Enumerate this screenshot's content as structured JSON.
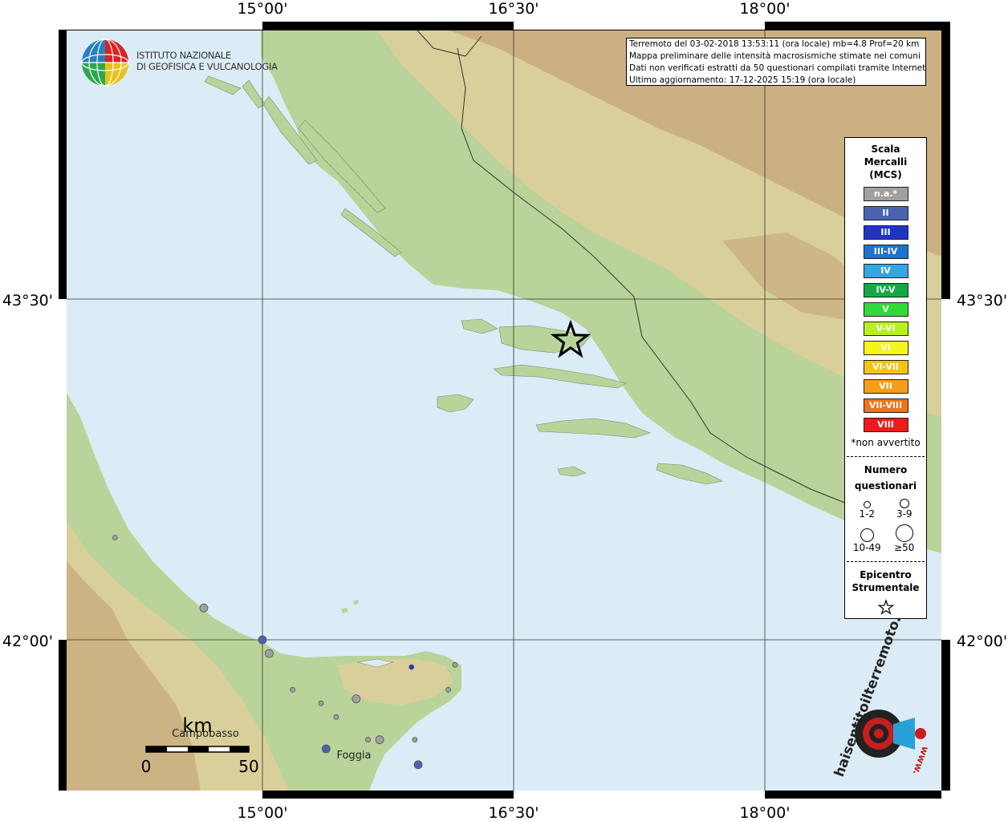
{
  "map": {
    "top_axis_labels": [
      "15°00'",
      "16°30'",
      "18°00'"
    ],
    "bottom_axis_labels": [
      "15°00'",
      "16°30'",
      "18°00'"
    ],
    "left_axis_labels": [
      "43°30'",
      "42°00'"
    ],
    "right_axis_labels": [
      "43°30'",
      "42°00'"
    ],
    "colors": {
      "sea": "#dcecf6",
      "lowland": "#b9d39a",
      "hills": "#d9cf9a",
      "mountain": "#c6a77a",
      "frame": "#000000"
    },
    "places": [
      "Campobasso",
      "Foggia"
    ],
    "scale_bar": {
      "unit": "km",
      "min_label": "0",
      "max_label": "50"
    },
    "epicenter": {
      "symbol": "star"
    },
    "observation_points": [
      {
        "lon": 14.12,
        "lat": 42.45,
        "intensity": "n.a.*",
        "size": "1-2"
      },
      {
        "lon": 14.65,
        "lat": 42.14,
        "intensity": "n.a.*",
        "size": "3-9"
      },
      {
        "lon": 15.0,
        "lat": 42.0,
        "intensity": "II",
        "size": "3-9"
      },
      {
        "lon": 15.04,
        "lat": 41.94,
        "intensity": "n.a.*",
        "size": "3-9"
      },
      {
        "lon": 15.18,
        "lat": 41.78,
        "intensity": "n.a.*",
        "size": "1-2"
      },
      {
        "lon": 15.35,
        "lat": 41.72,
        "intensity": "n.a.*",
        "size": "1-2"
      },
      {
        "lon": 15.44,
        "lat": 41.66,
        "intensity": "n.a.*",
        "size": "1-2"
      },
      {
        "lon": 15.56,
        "lat": 41.74,
        "intensity": "n.a.*",
        "size": "3-9"
      },
      {
        "lon": 15.38,
        "lat": 41.52,
        "intensity": "II",
        "size": "3-9"
      },
      {
        "lon": 15.63,
        "lat": 41.56,
        "intensity": "n.a.*",
        "size": "1-2"
      },
      {
        "lon": 15.7,
        "lat": 41.56,
        "intensity": "n.a.*",
        "size": "3-9"
      },
      {
        "lon": 15.91,
        "lat": 41.56,
        "intensity": "n.a.*",
        "size": "1-2"
      },
      {
        "lon": 15.89,
        "lat": 41.88,
        "intensity": "III",
        "size": "1-2"
      },
      {
        "lon": 16.11,
        "lat": 41.78,
        "intensity": "n.a.*",
        "size": "1-2"
      },
      {
        "lon": 16.15,
        "lat": 41.89,
        "intensity": "n.a.*",
        "size": "1-2"
      },
      {
        "lon": 15.93,
        "lat": 41.45,
        "intensity": "II",
        "size": "3-9"
      }
    ]
  },
  "logo": {
    "line1": "ISTITUTO NAZIONALE",
    "line2": "DI GEOFISICA E VULCANOLOGIA"
  },
  "info": {
    "line1": "Terremoto del 03-02-2018 13:53:11 (ora locale) mb=4.8 Prof=20 km",
    "line2": "Mappa preliminare delle intensità macrosismiche stimate nei comuni",
    "line3": "Dati non verificati estratti da 50 questionari compilati tramite Internet.",
    "line4": "Ultimo aggiornamento: 17-12-2025 15:19 (ora locale)"
  },
  "legend": {
    "title1": "Scala",
    "title2": "Mercalli",
    "title3": "(MCS)",
    "scale": [
      {
        "label": "n.a.*",
        "color": "#a0a0a0"
      },
      {
        "label": "II",
        "color": "#4a63b0"
      },
      {
        "label": "III",
        "color": "#1f35c2"
      },
      {
        "label": "III-IV",
        "color": "#1f73d0"
      },
      {
        "label": "IV",
        "color": "#31a6e0"
      },
      {
        "label": "IV-V",
        "color": "#15a845"
      },
      {
        "label": "V",
        "color": "#2fdc3a"
      },
      {
        "label": "V-VI",
        "color": "#b8f01e"
      },
      {
        "label": "VI",
        "color": "#f5f51a"
      },
      {
        "label": "VI-VII",
        "color": "#f5c21a"
      },
      {
        "label": "VII",
        "color": "#f59e1a"
      },
      {
        "label": "VII-VIII",
        "color": "#f0721a"
      },
      {
        "label": "VIII",
        "color": "#f01a1a"
      }
    ],
    "note": "*non avvertito",
    "count_title1": "Numero",
    "count_title2": "questionari",
    "counts": [
      "1-2",
      "3-9",
      "10-49",
      "≥50"
    ],
    "epicenter_title1": "Epicentro",
    "epicenter_title2": "Strumentale"
  },
  "badge": {
    "text": "haisentitoilterremoto.it",
    "url_text": "www."
  }
}
